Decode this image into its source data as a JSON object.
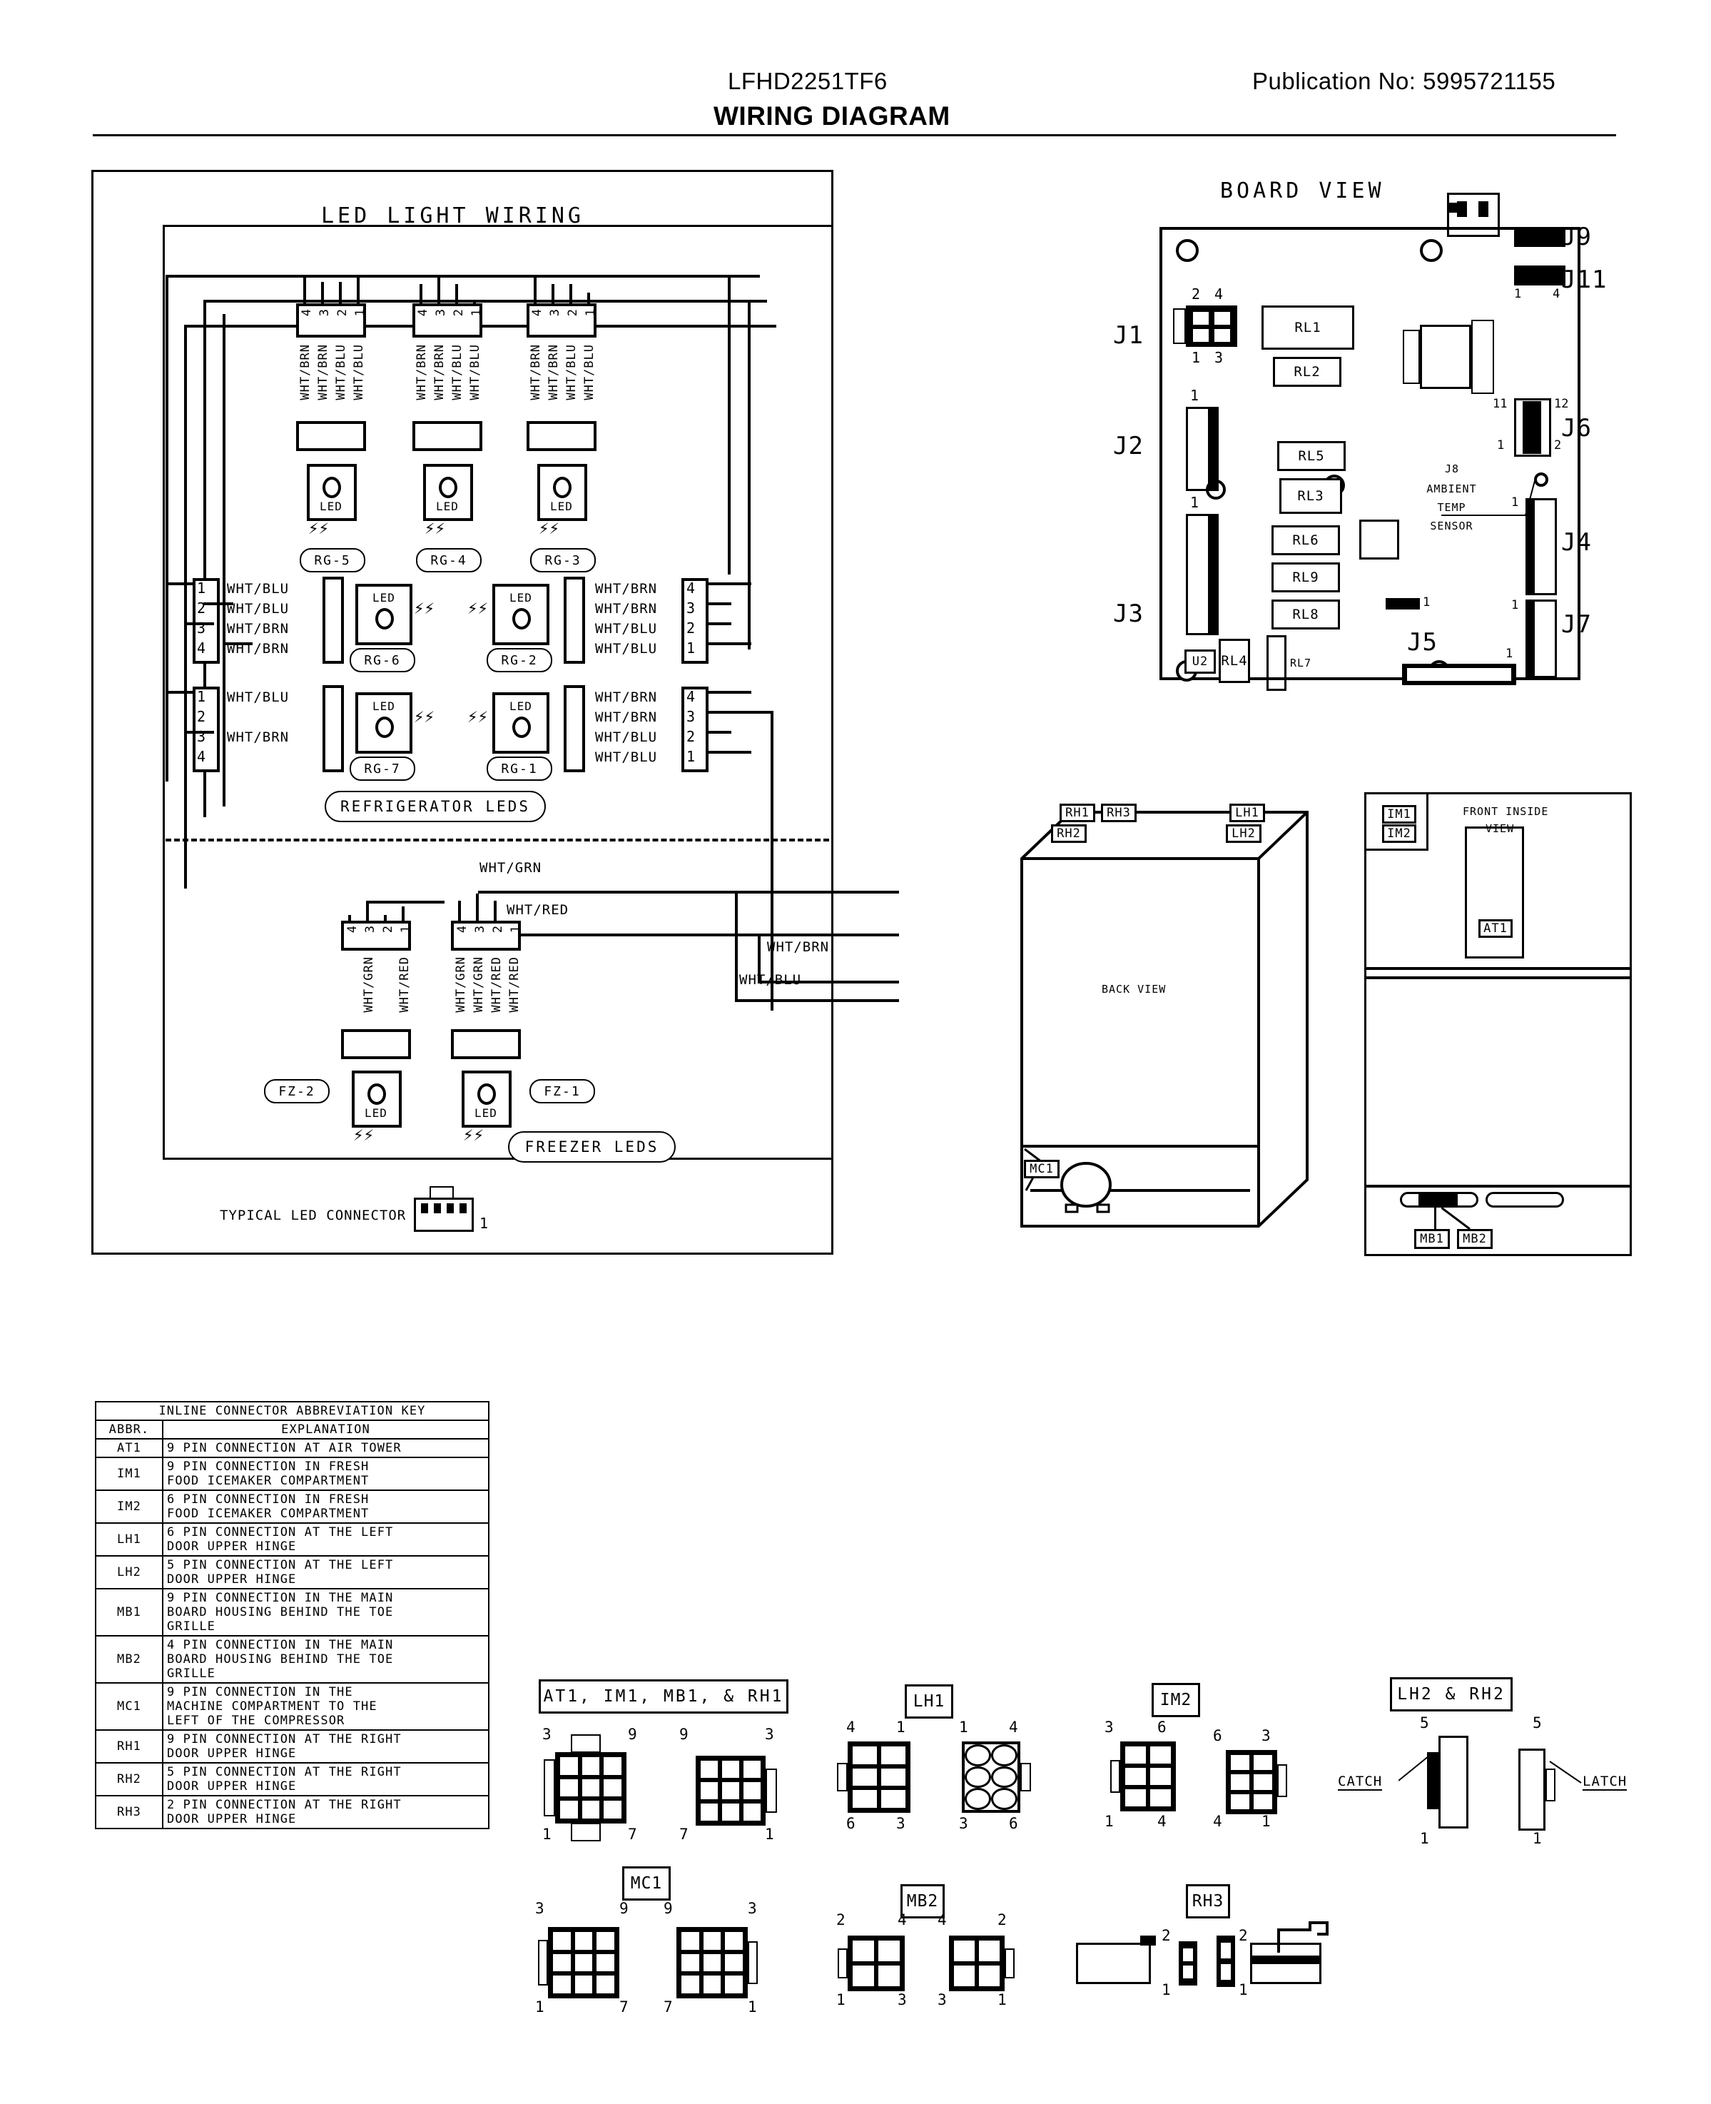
{
  "header": {
    "model": "LFHD2251TF6",
    "title": "WIRING DIAGRAM",
    "publication": "Publication No:  5995721155"
  },
  "led_panel": {
    "title": "LED LIGHT WIRING",
    "refrigerator_group_label": "REFRIGERATOR LEDS",
    "freezer_group_label": "FREEZER LEDS",
    "typical_connector_label": "TYPICAL LED CONNECTOR",
    "typical_connector_pin": "1",
    "led_text": "LED",
    "top_connectors": [
      {
        "tag": "RG-5",
        "pins": [
          "4",
          "3",
          "2",
          "1"
        ],
        "wires": [
          "WHT/BRN",
          "WHT/BRN",
          "WHT/BLU",
          "WHT/BLU"
        ]
      },
      {
        "tag": "RG-4",
        "pins": [
          "4",
          "3",
          "2",
          "1"
        ],
        "wires": [
          "WHT/BRN",
          "WHT/BRN",
          "WHT/BLU",
          "WHT/BLU"
        ]
      },
      {
        "tag": "RG-3",
        "pins": [
          "4",
          "3",
          "2",
          "1"
        ],
        "wires": [
          "WHT/BRN",
          "WHT/BRN",
          "WHT/BLU",
          "WHT/BLU"
        ]
      }
    ],
    "mid_connectors": [
      {
        "tag": "RG-6",
        "side": "left",
        "pins": [
          "1",
          "2",
          "3",
          "4"
        ],
        "wires": [
          "WHT/BLU",
          "WHT/BLU",
          "WHT/BRN",
          "WHT/BRN"
        ]
      },
      {
        "tag": "RG-2",
        "side": "right",
        "pins": [
          "4",
          "3",
          "2",
          "1"
        ],
        "wires": [
          "WHT/BRN",
          "WHT/BRN",
          "WHT/BLU",
          "WHT/BLU"
        ]
      },
      {
        "tag": "RG-7",
        "side": "left",
        "pins": [
          "1",
          "2",
          "3",
          "4"
        ],
        "wires": [
          "WHT/BLU",
          "",
          "WHT/BRN",
          ""
        ]
      },
      {
        "tag": "RG-1",
        "side": "right",
        "pins": [
          "4",
          "3",
          "2",
          "1"
        ],
        "wires": [
          "WHT/BRN",
          "WHT/BRN",
          "WHT/BLU",
          "WHT/BLU"
        ]
      }
    ],
    "freezer_connectors": [
      {
        "tag": "FZ-2",
        "pins": [
          "4",
          "3",
          "2",
          "1"
        ],
        "wires": [
          "",
          "WHT/GRN",
          "",
          "WHT/RED"
        ]
      },
      {
        "tag": "FZ-1",
        "pins": [
          "4",
          "3",
          "2",
          "1"
        ],
        "wires": [
          "WHT/GRN",
          "WHT/GRN",
          "WHT/RED",
          "WHT/RED"
        ]
      }
    ],
    "bus_labels": [
      "WHT/GRN",
      "WHT/RED",
      "WHT/BRN",
      "WHT/BLU"
    ]
  },
  "board": {
    "title": "BOARD VIEW",
    "connectors": [
      "J1",
      "J2",
      "J3",
      "J4",
      "J5",
      "J6",
      "J7",
      "J9",
      "J11"
    ],
    "j1_pins": {
      "top_left": "2",
      "top_right": "4",
      "bottom_left": "1",
      "bottom_right": "3"
    },
    "j11_pins": {
      "left": "1",
      "right": "4"
    },
    "j6_pins": {
      "top_left": "11",
      "top_right": "12",
      "bottom_left": "1",
      "bottom_right": "2"
    },
    "j2_pin1": "1",
    "j3_pin1": "1",
    "j4_pin1": "1",
    "j7_pin1": "1",
    "j5_pin1": "1",
    "j8_label": "J8\nAMBIENT\nTEMP\nSENSOR",
    "j8_lines": [
      "J8",
      "AMBIENT",
      "TEMP",
      "SENSOR"
    ],
    "small_hdr_pin": "1",
    "relays": [
      "RL1",
      "RL2",
      "RL5",
      "RL3",
      "RL6",
      "RL9",
      "RL8",
      "RL4",
      "RL7"
    ],
    "ic": "U2"
  },
  "back_view": {
    "label": "BACK VIEW",
    "tags": [
      "RH1",
      "RH3",
      "LH1",
      "RH2",
      "LH2",
      "MC1"
    ]
  },
  "front_view": {
    "label_line1": "FRONT INSIDE",
    "label_line2": "VIEW",
    "tags": [
      "IM1",
      "IM2",
      "AT1",
      "MB1",
      "MB2"
    ]
  },
  "key_table": {
    "title": "INLINE CONNECTOR ABBREVIATION KEY",
    "columns": [
      "ABBR.",
      "EXPLANATION"
    ],
    "rows": [
      {
        "abbr": "AT1",
        "explanation": "9 PIN CONNECTION AT AIR TOWER"
      },
      {
        "abbr": "IM1",
        "explanation": "9 PIN CONNECTION IN FRESH\nFOOD ICEMAKER COMPARTMENT"
      },
      {
        "abbr": "IM2",
        "explanation": "6 PIN CONNECTION IN FRESH\nFOOD ICEMAKER COMPARTMENT"
      },
      {
        "abbr": "LH1",
        "explanation": "6 PIN CONNECTION AT THE LEFT\nDOOR UPPER HINGE"
      },
      {
        "abbr": "LH2",
        "explanation": "5 PIN CONNECTION AT THE LEFT\nDOOR UPPER HINGE"
      },
      {
        "abbr": "MB1",
        "explanation": "9 PIN CONNECTION IN THE MAIN\nBOARD HOUSING BEHIND THE TOE\nGRILLE"
      },
      {
        "abbr": "MB2",
        "explanation": "4 PIN CONNECTION IN THE MAIN\nBOARD HOUSING BEHIND THE TOE\nGRILLE"
      },
      {
        "abbr": "MC1",
        "explanation": "9 PIN CONNECTION IN THE\nMACHINE COMPARTMENT TO THE\nLEFT OF THE COMPRESSOR"
      },
      {
        "abbr": "RH1",
        "explanation": "9 PIN CONNECTION AT THE RIGHT\nDOOR UPPER HINGE"
      },
      {
        "abbr": "RH2",
        "explanation": "5 PIN CONNECTION AT THE RIGHT\nDOOR UPPER HINGE"
      },
      {
        "abbr": "RH3",
        "explanation": "2 PIN CONNECTION AT THE RIGHT\nDOOR UPPER HINGE"
      }
    ]
  },
  "connector_figures": {
    "group1": {
      "label": "AT1, IM1, MB1, & RH1",
      "left_pins": [
        "3",
        "9",
        "1",
        "7"
      ],
      "right_pins": [
        "9",
        "3",
        "7",
        "1"
      ]
    },
    "lh1": {
      "label": "LH1",
      "left_pins": [
        "4",
        "1",
        "6",
        "3"
      ],
      "right_pins": [
        "1",
        "4",
        "3",
        "6"
      ]
    },
    "im2": {
      "label": "IM2",
      "left_pins": [
        "3",
        "6",
        "1",
        "4"
      ],
      "right_pins": [
        "6",
        "3",
        "4",
        "1"
      ]
    },
    "lh2rh2": {
      "label": "LH2 & RH2",
      "catch": "CATCH",
      "latch": "LATCH",
      "left_pins": [
        "5",
        "1"
      ],
      "right_pins": [
        "5",
        "1"
      ]
    },
    "mc1": {
      "label": "MC1",
      "left_pins": [
        "3",
        "9",
        "1",
        "7"
      ],
      "right_pins": [
        "9",
        "3",
        "7",
        "1"
      ]
    },
    "mb2": {
      "label": "MB2",
      "left_pins": [
        "2",
        "4",
        "1",
        "3"
      ],
      "right_pins": [
        "4",
        "2",
        "3",
        "1"
      ]
    },
    "rh3": {
      "label": "RH3",
      "left_pins": [
        "2",
        "1"
      ],
      "right_pins": [
        "2",
        "1"
      ]
    }
  },
  "colors": {
    "ink": "#000000",
    "paper": "#ffffff"
  }
}
